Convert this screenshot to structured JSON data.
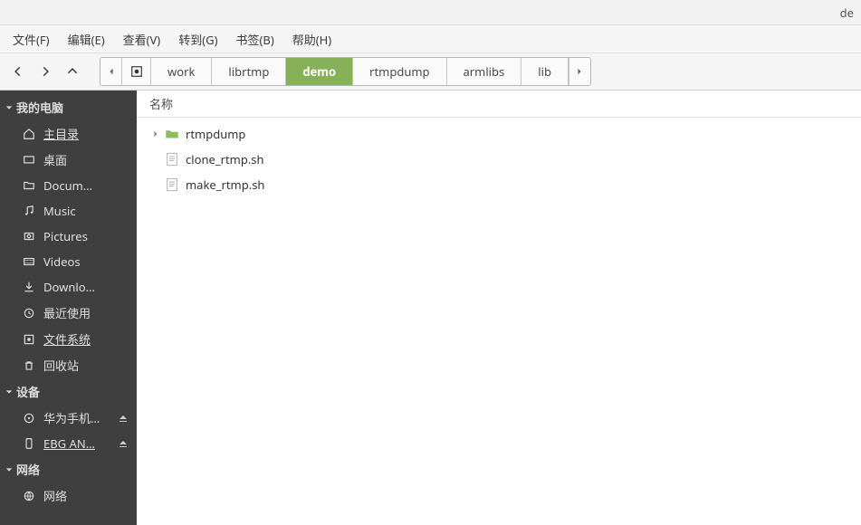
{
  "title_fragment": "de",
  "menu": {
    "file": "文件(F)",
    "edit": "编辑(E)",
    "view": "查看(V)",
    "go": "转到(G)",
    "bookmarks": "书签(B)",
    "help": "帮助(H)"
  },
  "breadcrumbs": {
    "items": [
      {
        "label": "work",
        "active": false
      },
      {
        "label": "librtmp",
        "active": false
      },
      {
        "label": "demo",
        "active": true
      },
      {
        "label": "rtmpdump",
        "active": false
      },
      {
        "label": "armlibs",
        "active": false
      },
      {
        "label": "lib",
        "active": false
      }
    ]
  },
  "sidebar": {
    "sections": {
      "computer": {
        "label": "我的电脑",
        "items": [
          {
            "label": "主目录",
            "icon": "home",
            "underline": true
          },
          {
            "label": "桌面",
            "icon": "desktop"
          },
          {
            "label": "Docum…",
            "icon": "folder"
          },
          {
            "label": "Music",
            "icon": "music"
          },
          {
            "label": "Pictures",
            "icon": "pictures"
          },
          {
            "label": "Videos",
            "icon": "videos"
          },
          {
            "label": "Downlo…",
            "icon": "download"
          },
          {
            "label": "最近使用",
            "icon": "recent"
          },
          {
            "label": "文件系统",
            "icon": "filesystem",
            "underline": true
          },
          {
            "label": "回收站",
            "icon": "trash"
          }
        ]
      },
      "devices": {
        "label": "设备",
        "items": [
          {
            "label": "华为手机…",
            "icon": "disc",
            "eject": true
          },
          {
            "label": "EBG AN…",
            "icon": "phone",
            "underline": true,
            "eject": true
          }
        ]
      },
      "network": {
        "label": "网络",
        "items": [
          {
            "label": "网络",
            "icon": "globe"
          }
        ]
      }
    }
  },
  "file_list": {
    "header": "名称",
    "items": [
      {
        "name": "rtmpdump",
        "type": "folder",
        "expandable": true
      },
      {
        "name": "clone_rtmp.sh",
        "type": "script"
      },
      {
        "name": "make_rtmp.sh",
        "type": "script"
      }
    ]
  },
  "colors": {
    "active_breadcrumb": "#87b158",
    "folder": "#8bbf5d",
    "sidebar_bg": "#3f3f3f"
  }
}
